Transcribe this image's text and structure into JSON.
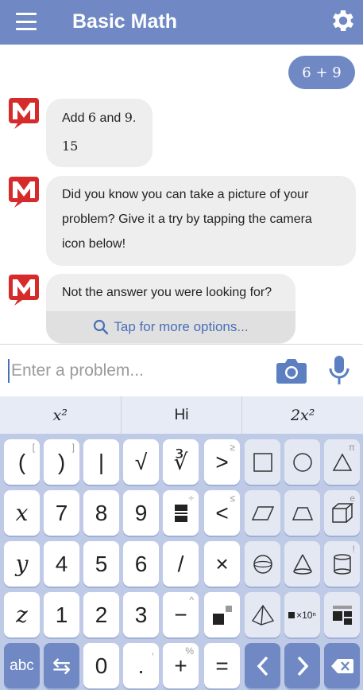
{
  "header": {
    "title": "Basic Math",
    "menu_icon": "hamburger-menu-icon",
    "settings_icon": "gear-icon",
    "color": "#7089c4"
  },
  "chat": {
    "user_message": "6 + 9",
    "messages": [
      {
        "line1_prefix": "Add ",
        "line1_a": "6",
        "line1_mid": " and ",
        "line1_b": "9",
        "line1_suffix": ".",
        "line2": "15"
      },
      {
        "line1": "Did you know you can take a picture of your",
        "line2": "problem? Give it a try by tapping the camera",
        "line3": "icon below!"
      },
      {
        "line1": "Not the answer you were looking for?"
      }
    ],
    "more_options": "Tap for more options..."
  },
  "input": {
    "placeholder": "Enter a problem...",
    "camera_icon": "camera-icon",
    "mic_icon": "microphone-icon"
  },
  "suggestions": [
    "x²",
    "Hi",
    "2x²"
  ],
  "keyboard": {
    "row1": [
      "(",
      ")",
      "|",
      "√",
      "∛",
      ">",
      "",
      "",
      ""
    ],
    "row1_sup": [
      "[",
      "]",
      "",
      "",
      "",
      "≥",
      "",
      "",
      "π"
    ],
    "row2": [
      "x",
      "7",
      "8",
      "9",
      "",
      "<",
      "",
      "",
      ""
    ],
    "row2_sup": [
      "",
      "",
      "",
      "",
      "÷",
      "≤",
      "",
      "",
      "e"
    ],
    "row3": [
      "y",
      "4",
      "5",
      "6",
      "/",
      "×",
      "",
      "",
      ""
    ],
    "row3_sup": [
      "",
      "",
      "",
      "",
      "",
      "",
      "",
      "",
      "!"
    ],
    "row4": [
      "z",
      "1",
      "2",
      "3",
      "−",
      "",
      "",
      "×10ⁿ",
      ""
    ],
    "row4_sup": [
      "",
      "",
      "",
      "",
      "^",
      "",
      "",
      "",
      ""
    ],
    "row5": [
      "abc",
      "⇆",
      "0",
      ".",
      "+",
      "=",
      "<",
      ">",
      "⌫"
    ],
    "row5_sup": [
      "",
      "",
      "",
      ",",
      "%",
      "",
      "",
      "",
      ""
    ]
  }
}
